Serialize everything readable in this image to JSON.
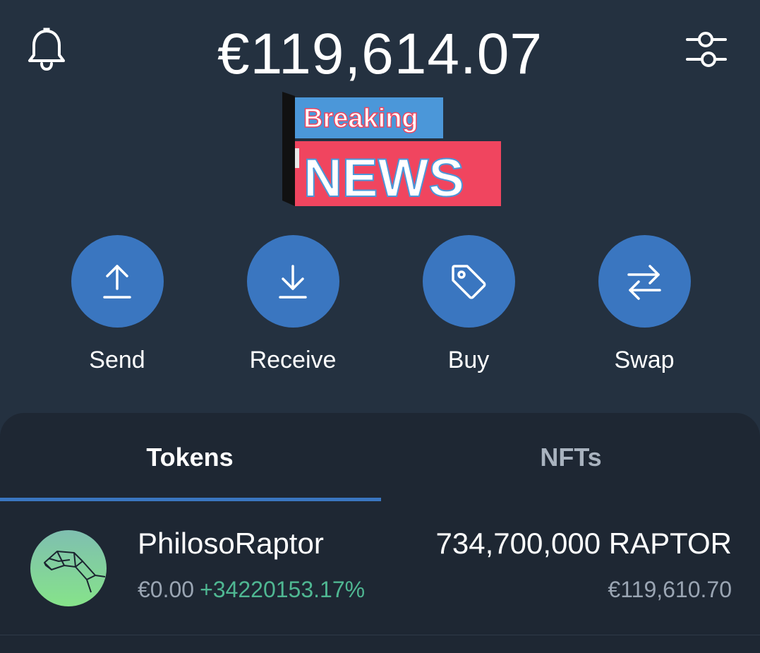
{
  "header": {
    "balance": "€119,614.07",
    "bell_icon": "bell-icon",
    "settings_icon": "sliders-icon"
  },
  "news_banner": {
    "line1": "Breaking",
    "line2": "NEWS"
  },
  "actions": [
    {
      "label": "Send",
      "icon": "arrow-up-icon"
    },
    {
      "label": "Receive",
      "icon": "arrow-down-icon"
    },
    {
      "label": "Buy",
      "icon": "tag-icon"
    },
    {
      "label": "Swap",
      "icon": "swap-arrows-icon"
    }
  ],
  "tabs": [
    {
      "label": "Tokens",
      "active": true
    },
    {
      "label": "NFTs",
      "active": false
    }
  ],
  "tokens": [
    {
      "name": "PhilosoRaptor",
      "price": "€0.00",
      "change": "+34220153.17%",
      "amount": "734,700,000 RAPTOR",
      "value": "€119,610.70"
    }
  ],
  "colors": {
    "background": "#243140",
    "panel": "#1e2733",
    "accent": "#3a76c0",
    "positive_change": "#4fb792",
    "muted_text": "#9aa5b3"
  }
}
